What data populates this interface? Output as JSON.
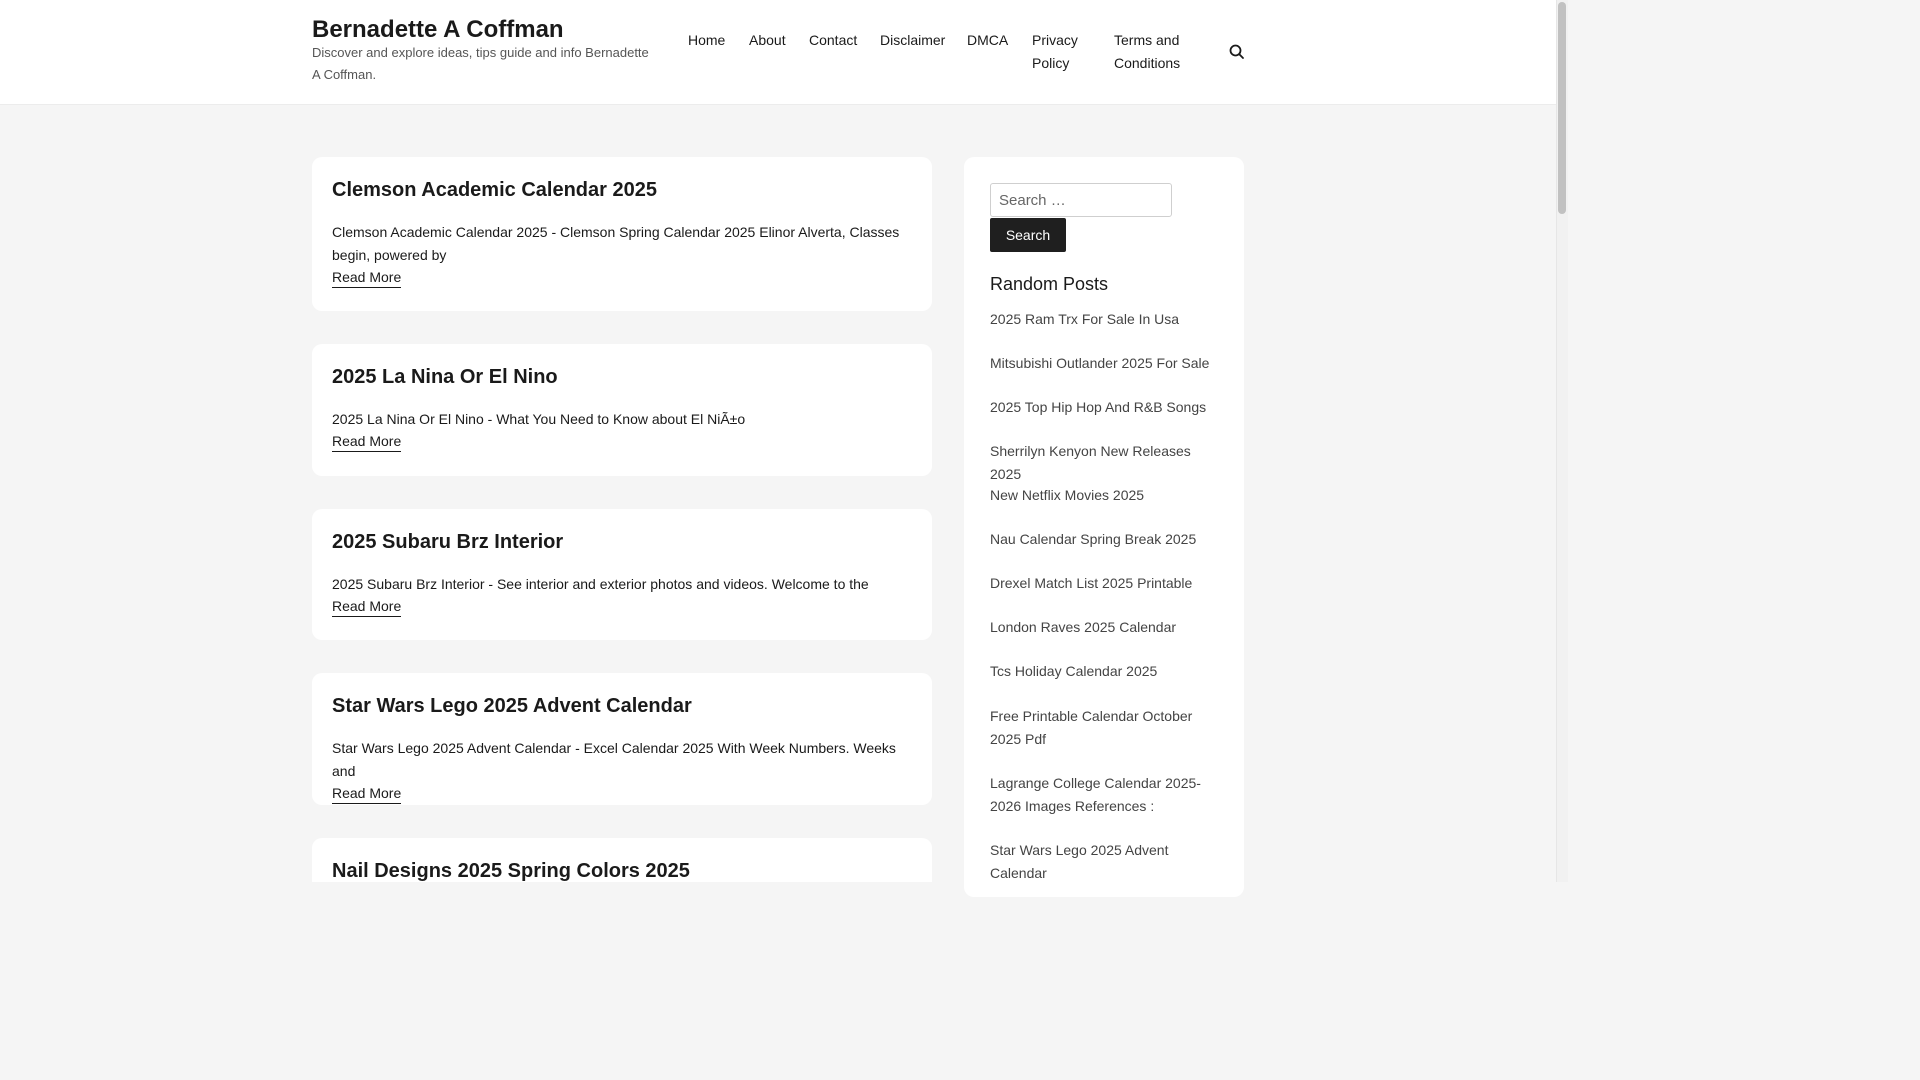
{
  "site": {
    "title": "Bernadette A Coffman",
    "description": "Discover and explore ideas, tips guide and info Bernadette A Coffman."
  },
  "nav": {
    "items": [
      {
        "label": "Home"
      },
      {
        "label": "About"
      },
      {
        "label": "Contact"
      },
      {
        "label": "Disclaimer"
      },
      {
        "label": "DMCA"
      },
      {
        "label": "Privacy Policy"
      },
      {
        "label": "Terms and Conditions"
      }
    ],
    "search_icon": "search-icon"
  },
  "posts": [
    {
      "title": "Clemson Academic Calendar 2025",
      "excerpt": "Clemson Academic Calendar 2025 - Clemson Spring Calendar 2025 Elinor Alverta, Classes begin, powered by",
      "read_more": "Read More"
    },
    {
      "title": "2025 La Nina Or El Nino",
      "excerpt": "2025 La Nina Or El Nino - What You Need to Know about El NiÃ±o",
      "read_more": "Read More"
    },
    {
      "title": "2025 Subaru Brz Interior",
      "excerpt": "2025 Subaru Brz Interior - See interior and exterior photos and videos. Welcome to the",
      "read_more": "Read More"
    },
    {
      "title": "Star Wars Lego 2025 Advent Calendar",
      "excerpt": "Star Wars Lego 2025 Advent Calendar - Excel Calendar 2025 With Week Numbers. Weeks and",
      "read_more": "Read More"
    },
    {
      "title": "Nail Designs 2025 Spring Colors 2025"
    }
  ],
  "sidebar": {
    "search": {
      "placeholder": "Search …",
      "button_label": "Search"
    },
    "random_posts": {
      "title": "Random Posts",
      "items": [
        "2025 Ram Trx For Sale In Usa",
        "Mitsubishi Outlander 2025 For Sale",
        "2025 Top Hip Hop And R&B Songs",
        "Sherrilyn Kenyon New Releases 2025",
        "New Netflix Movies 2025",
        "Nau Calendar Spring Break 2025",
        "Drexel Match List 2025 Printable",
        "London Raves 2025 Calendar",
        "Tcs Holiday Calendar 2025",
        "Free Printable Calendar October 2025 Pdf",
        "Lagrange College Calendar 2025-2026 Images References :",
        "Star Wars Lego 2025 Advent Calendar"
      ]
    }
  },
  "colors": {
    "page_background": "#f5f5f5",
    "card_background": "#ffffff",
    "text": "#1a1a1a",
    "muted_text": "#555555",
    "button_background": "#1f1f1f"
  }
}
